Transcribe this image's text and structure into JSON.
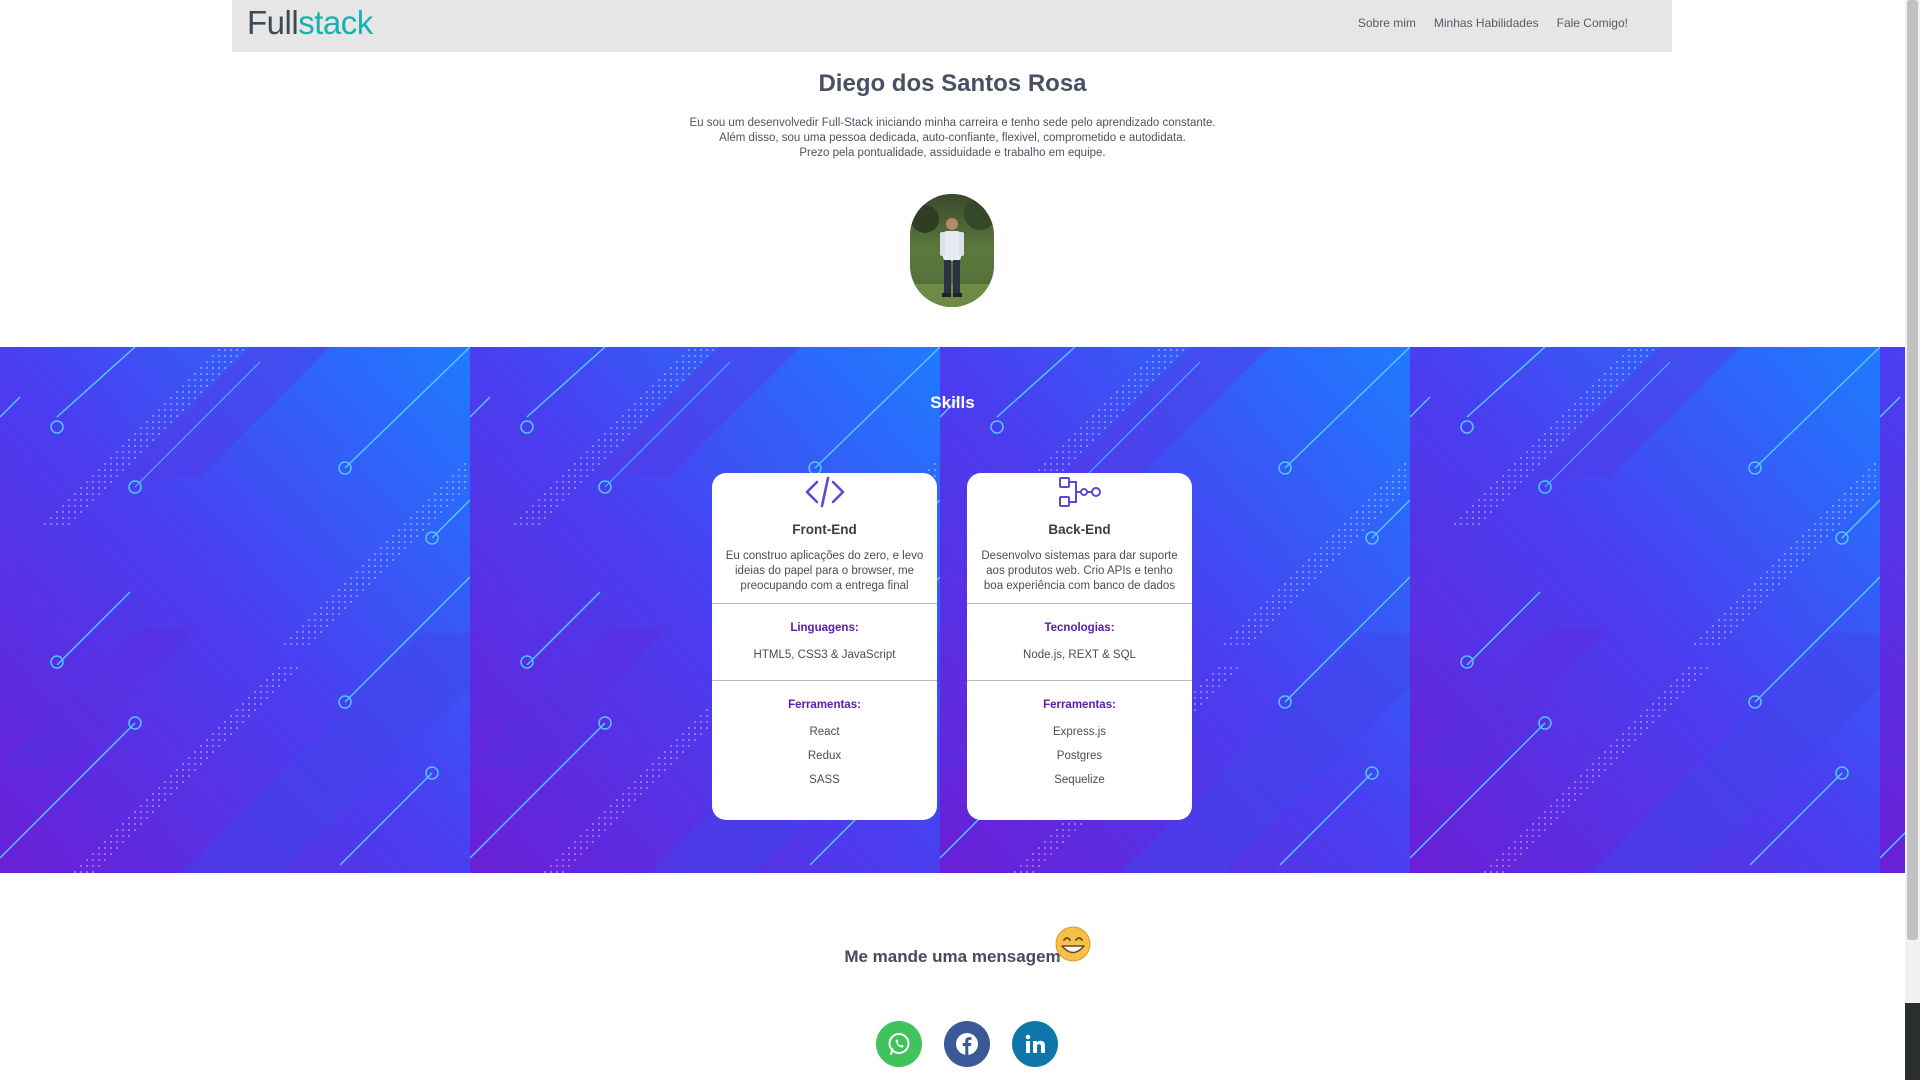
{
  "navbar": {
    "logo_part1": "Full",
    "logo_part2": "stack",
    "links": [
      "Sobre mim",
      "Minhas Habilidades",
      "Fale Comigo!"
    ]
  },
  "hero": {
    "name": "Diego dos Santos Rosa",
    "bio_lines": [
      "Eu sou um desenvolvedir Full-Stack iniciando minha carreira e tenho sede pelo aprendizado constante.",
      "Além disso, sou uma pessoa dedicada, auto-confiante, flexivel, comprometido e autodidata.",
      "Prezo pela pontualidade, assiduidade e trabalho em equipe."
    ]
  },
  "skills": {
    "title": "Skills",
    "cards": [
      {
        "icon": "code-icon",
        "title": "Front-End",
        "description": "Eu construo aplicações do zero, e levo ideias do papel para o browser, me preocupando com a entrega final",
        "section1_title": "Linguagens:",
        "section1_text": "HTML5, CSS3 & JavaScript",
        "section2_title": "Ferramentas:",
        "section2_items": [
          "React",
          "Redux",
          "SASS"
        ]
      },
      {
        "icon": "flow-nodes-icon",
        "title": "Back-End",
        "description": "Desenvolvo sistemas para dar suporte aos produtos web. Crio APIs e tenho boa experiência com banco de dados",
        "section1_title": "Tecnologias:",
        "section1_text": "Node.js, REXT & SQL",
        "section2_title": "Ferramentas:",
        "section2_items": [
          "Express.js",
          "Postgres",
          "Sequelize"
        ]
      }
    ]
  },
  "contact": {
    "title": "Me mande uma mensagem",
    "emoji_icon": "grinning-face-icon",
    "socials": [
      {
        "name": "whatsapp-icon",
        "color": "#3fc35a"
      },
      {
        "name": "facebook-icon",
        "color": "#3b5998"
      },
      {
        "name": "linkedin-icon",
        "color": "#0e76a8"
      }
    ]
  },
  "colors": {
    "accent_purple": "#5a1ba8",
    "logo_teal": "#17b2b0",
    "band_purple": "#6a1fd6",
    "band_blue": "#1f7bff"
  }
}
